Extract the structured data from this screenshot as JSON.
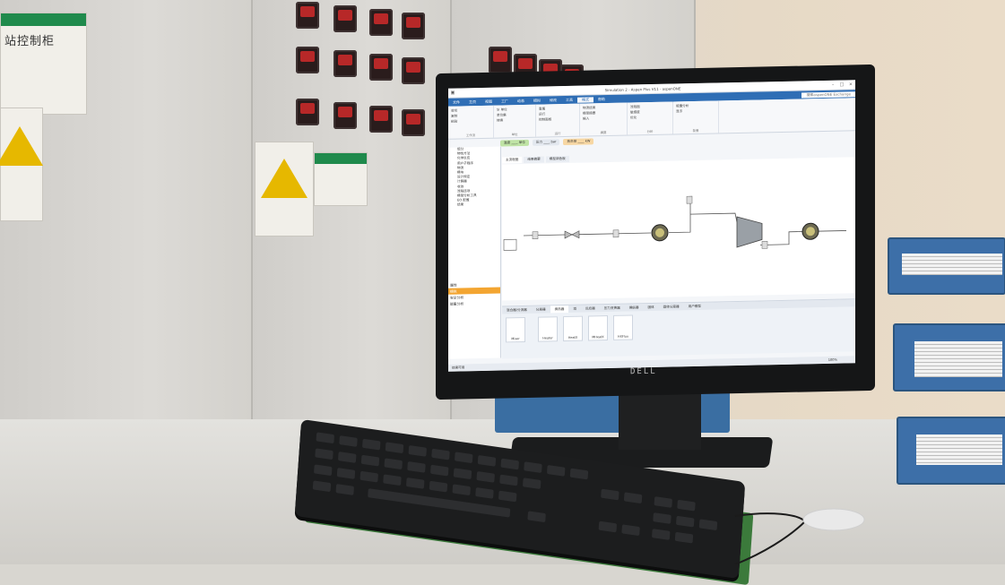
{
  "scene": {
    "description_tags": [
      "control-room",
      "desk",
      "monitor",
      "keyboard",
      "electrical-cabinets",
      "document-trays"
    ],
    "monitor_brand": "DELL",
    "cabinet_sign_text": "站控制柜"
  },
  "screen": {
    "window_title": "Simulation 2 - Aspen Plus V11 - aspenONE",
    "search_placeholder": "搜索aspenONE Exchange",
    "menu": [
      "文件",
      "主页",
      "视图",
      "工厂",
      "动态",
      "模拟",
      "修改",
      "工具",
      "格式",
      "帮助"
    ],
    "active_menu": "格式",
    "ribbon_groups": [
      {
        "label": "工作流",
        "items": [
          "剪切",
          "复制",
          "粘贴"
        ]
      },
      {
        "label": "单位",
        "items": [
          "SI 单位",
          "单位集",
          "转换"
        ]
      },
      {
        "label": "运行",
        "items": [
          "重置",
          "运行",
          "控制面板"
        ]
      },
      {
        "label": "摘要",
        "items": [
          "物流结果",
          "模型摘要",
          "输入"
        ]
      },
      {
        "label": "分析",
        "items": [
          "流程图",
          "敏感度",
          "优化"
        ]
      },
      {
        "label": "能量",
        "items": [
          "能量分析",
          "显示"
        ]
      }
    ],
    "status_pills": [
      "温度 ____ 单位",
      "压力 ____ bar",
      "热负荷 ____ kW"
    ],
    "flowsheet_tabs": [
      "主流程图",
      "结果摘要",
      "模型调色板"
    ],
    "nav_items": [
      "组分",
      "物性方法",
      "化学反应",
      "用户子程序",
      "物流",
      "模块",
      "设计规定",
      "计算器",
      "收敛",
      "流程选项",
      "模型分析工具",
      "EO 配置",
      "结果"
    ],
    "nav_sections": [
      "属性",
      "模拟",
      "安全分析",
      "能量分析"
    ],
    "active_nav_section": "模拟",
    "palette_tabs": [
      "混合器/分流器",
      "分离器",
      "换热器",
      "塔",
      "反应器",
      "压力变换器",
      "操纵器",
      "固体",
      "固体分离器",
      "用户模型"
    ],
    "active_palette_tab": "换热器",
    "palette_items": [
      "Mixer",
      "Heater",
      "HeatX",
      "MHeatX",
      "HXFlux"
    ],
    "statusbar_left": "结果可用",
    "statusbar_zoom": "100%"
  },
  "colors": {
    "ribbon_accent": "#2f6eb5",
    "active_tab": "#f3a531",
    "cabinet_led": "#c62a2a",
    "tray_blue": "#3d6fa8",
    "mat_green": "#3b7a3b"
  }
}
